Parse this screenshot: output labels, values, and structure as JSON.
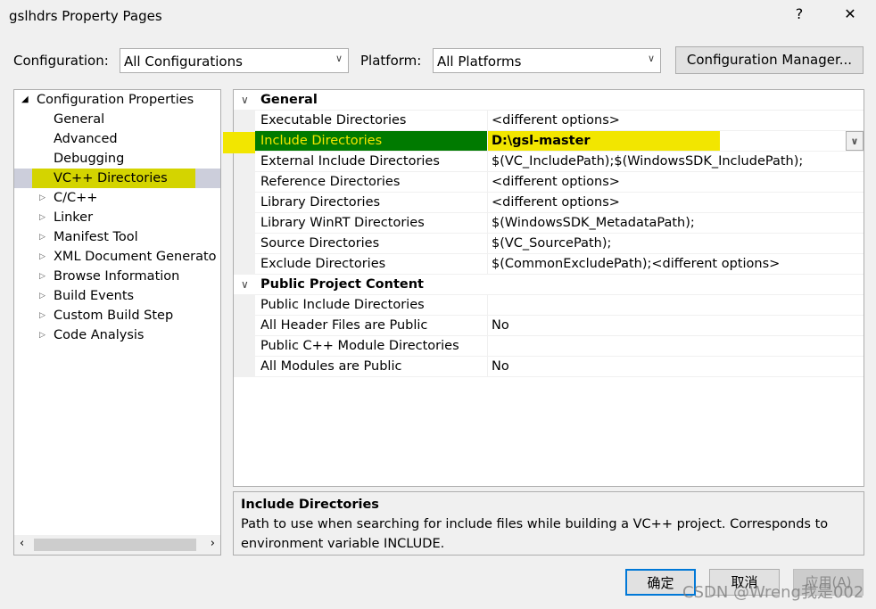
{
  "window": {
    "title": "gslhdrs Property Pages",
    "help": "?",
    "close": "✕"
  },
  "config": {
    "label": "Configuration:",
    "value": "All Configurations",
    "platform_label": "Platform:",
    "platform_value": "All Platforms",
    "manager_button": "Configuration Manager..."
  },
  "tree": {
    "root": "Configuration Properties",
    "items": [
      {
        "label": "General",
        "expandable": false
      },
      {
        "label": "Advanced",
        "expandable": false
      },
      {
        "label": "Debugging",
        "expandable": false
      },
      {
        "label": "VC++ Directories",
        "expandable": false,
        "selected": true
      },
      {
        "label": "C/C++",
        "expandable": true
      },
      {
        "label": "Linker",
        "expandable": true
      },
      {
        "label": "Manifest Tool",
        "expandable": true
      },
      {
        "label": "XML Document Generato",
        "expandable": true
      },
      {
        "label": "Browse Information",
        "expandable": true
      },
      {
        "label": "Build Events",
        "expandable": true
      },
      {
        "label": "Custom Build Step",
        "expandable": true
      },
      {
        "label": "Code Analysis",
        "expandable": true
      }
    ]
  },
  "grid": {
    "general": "General",
    "general_rows": [
      {
        "name": "Executable Directories",
        "value": "<different options>"
      },
      {
        "name": "Include Directories",
        "value": "D:\\gsl-master",
        "selected": true
      },
      {
        "name": "External Include Directories",
        "value": "$(VC_IncludePath);$(WindowsSDK_IncludePath);"
      },
      {
        "name": "Reference Directories",
        "value": "<different options>"
      },
      {
        "name": "Library Directories",
        "value": "<different options>"
      },
      {
        "name": "Library WinRT Directories",
        "value": "$(WindowsSDK_MetadataPath);"
      },
      {
        "name": "Source Directories",
        "value": "$(VC_SourcePath);"
      },
      {
        "name": "Exclude Directories",
        "value": "$(CommonExcludePath);<different options>"
      }
    ],
    "public": "Public Project Content",
    "public_rows": [
      {
        "name": "Public Include Directories",
        "value": ""
      },
      {
        "name": "All Header Files are Public",
        "value": "No"
      },
      {
        "name": "Public C++ Module Directories",
        "value": ""
      },
      {
        "name": "All Modules are Public",
        "value": "No"
      }
    ]
  },
  "description": {
    "title": "Include Directories",
    "text": "Path to use when searching for include files while building a VC++ project.  Corresponds to environment variable INCLUDE."
  },
  "buttons": {
    "ok": "确定",
    "cancel": "取消",
    "apply": "应用(A)"
  },
  "watermark": "CSDN @Wreng我是002",
  "colors": {
    "highlight_yellow": "#f2e600",
    "selected_green": "#007a00",
    "tree_highlight": "#d4d400"
  }
}
